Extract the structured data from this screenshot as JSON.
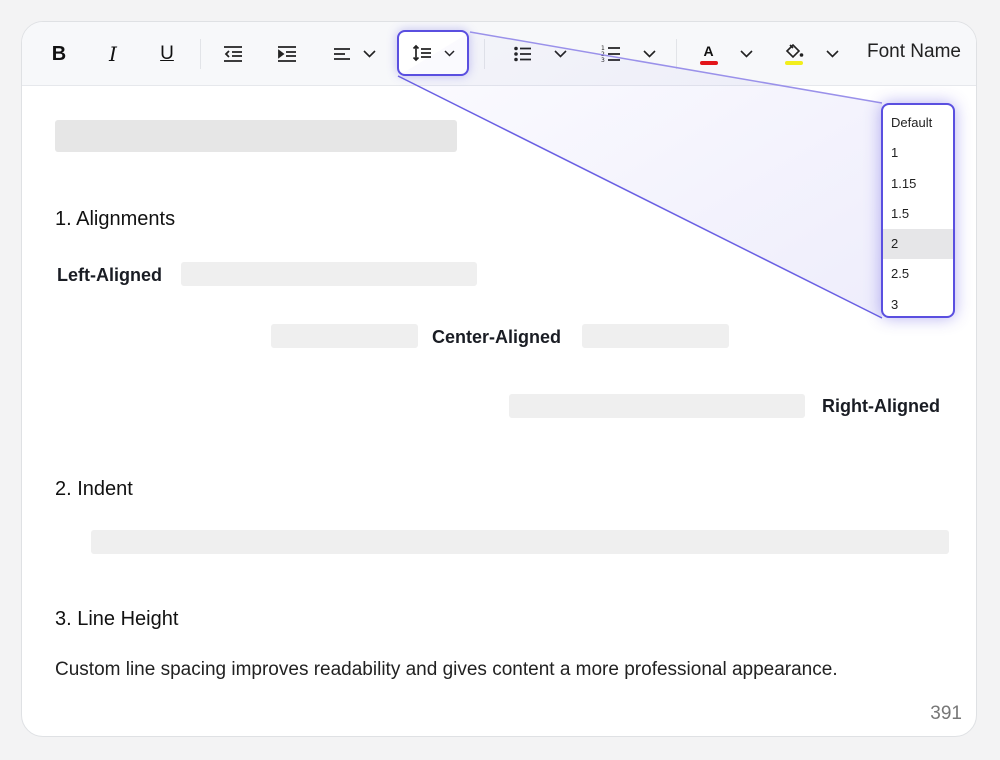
{
  "toolbar": {
    "bold_glyph": "B",
    "italic_glyph": "I",
    "underline_glyph": "U",
    "font_color_glyph": "A",
    "font_color": "#e3151a",
    "highlight_color": "#f2ee1c",
    "font_name_label": "Font Name",
    "icons": [
      "bold-icon",
      "italic-icon",
      "underline-icon",
      "outdent-icon",
      "indent-icon",
      "align-left-icon",
      "line-height-icon",
      "bullet-list-icon",
      "numbered-list-icon",
      "font-color-icon",
      "highlight-icon",
      "chevron-down-icon"
    ]
  },
  "line_height_menu": {
    "options": [
      "Default",
      "1",
      "1.15",
      "1.5",
      "2",
      "2.5",
      "3"
    ],
    "selected": "2"
  },
  "content": {
    "section1_heading": "1. Alignments",
    "left_label": "Left-Aligned",
    "center_label": "Center-Aligned",
    "right_label": "Right-Aligned",
    "section2_heading": "2. Indent",
    "section3_heading": "3. Line Height",
    "body_text": "Custom line spacing improves readability and gives content a more professional appearance."
  },
  "footer": {
    "char_count": "391"
  },
  "colors": {
    "accent": "#5a4fe0",
    "placeholder": "#efefef",
    "toolbar_bg": "#f7f8fa"
  }
}
